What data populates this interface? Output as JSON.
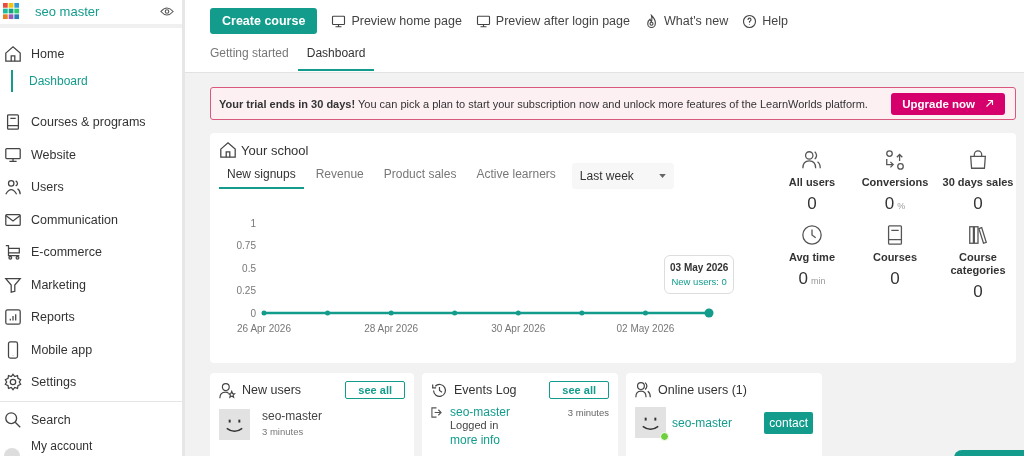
{
  "brand": {
    "name": "seo master"
  },
  "sidebar": {
    "items": [
      {
        "label": "Home",
        "selected": false,
        "children": [
          {
            "label": "Dashboard",
            "selected": true
          }
        ]
      },
      {
        "label": "Courses & programs",
        "selected": false
      },
      {
        "label": "Website",
        "selected": false
      },
      {
        "label": "Users",
        "selected": false
      },
      {
        "label": "Communication",
        "selected": false
      },
      {
        "label": "E-commerce",
        "selected": false
      },
      {
        "label": "Marketing",
        "selected": false
      },
      {
        "label": "Reports",
        "selected": false
      },
      {
        "label": "Mobile app",
        "selected": false
      },
      {
        "label": "Settings",
        "selected": false
      }
    ],
    "footer": [
      {
        "label": "Search"
      },
      {
        "label": "My account"
      }
    ]
  },
  "toolbar": {
    "primary": "Create course",
    "links": [
      "Preview home page",
      "Preview after login page",
      "What's new",
      "Help"
    ]
  },
  "tabs": [
    {
      "label": "Getting started",
      "selected": false
    },
    {
      "label": "Dashboard",
      "selected": true
    }
  ],
  "banner": {
    "text": "**Your trial ends in 30 days!** You can pick a plan to start your subscription now and unlock more features of the LearnWorlds platform.",
    "button": "Upgrade now"
  },
  "school": {
    "title": "Your school",
    "tabs": [
      {
        "label": "New signups",
        "selected": true
      },
      {
        "label": "Revenue",
        "selected": false
      },
      {
        "label": "Product sales",
        "selected": false
      },
      {
        "label": "Active learners",
        "selected": false
      }
    ],
    "period": "Last week",
    "chart_data": {
      "type": "line",
      "categories": [
        "26 Apr 2026",
        null,
        "28 Apr 2026",
        null,
        "30 Apr 2026",
        null,
        "02 May 2026",
        null
      ],
      "ylim": [
        0,
        1
      ],
      "yticks": [
        0,
        0.25,
        0.5,
        0.75,
        1
      ],
      "series": [
        {
          "color": "#139c8c",
          "values": [
            0,
            0,
            0,
            0,
            0,
            0,
            0,
            0
          ]
        }
      ]
    },
    "tooltip": {
      "date": "03 May 2026",
      "text": "New users: 0"
    },
    "stats": [
      {
        "label": "All users",
        "value": "0"
      },
      {
        "label": "Conversions",
        "value": "0",
        "unit": "%"
      },
      {
        "label": "30 days sales",
        "value": "0"
      },
      {
        "label": "Avg time",
        "value": "0",
        "unit": "min"
      },
      {
        "label": "Courses",
        "value": "0"
      },
      {
        "label": "Course categories",
        "value": "0"
      }
    ]
  },
  "new_users": {
    "title": "New users",
    "button": "see all",
    "items": [
      {
        "name": "seo-master",
        "time": "3 minutes"
      }
    ]
  },
  "events_log": {
    "title": "Events Log",
    "button": "see all",
    "items": [
      {
        "user": "seo-master",
        "time": "3 minutes",
        "action": "Logged in",
        "link": "more info"
      }
    ]
  },
  "online_users": {
    "title": "Online users (1)",
    "items": [
      {
        "name": "seo-master",
        "online": true,
        "button": "contact"
      }
    ]
  }
}
